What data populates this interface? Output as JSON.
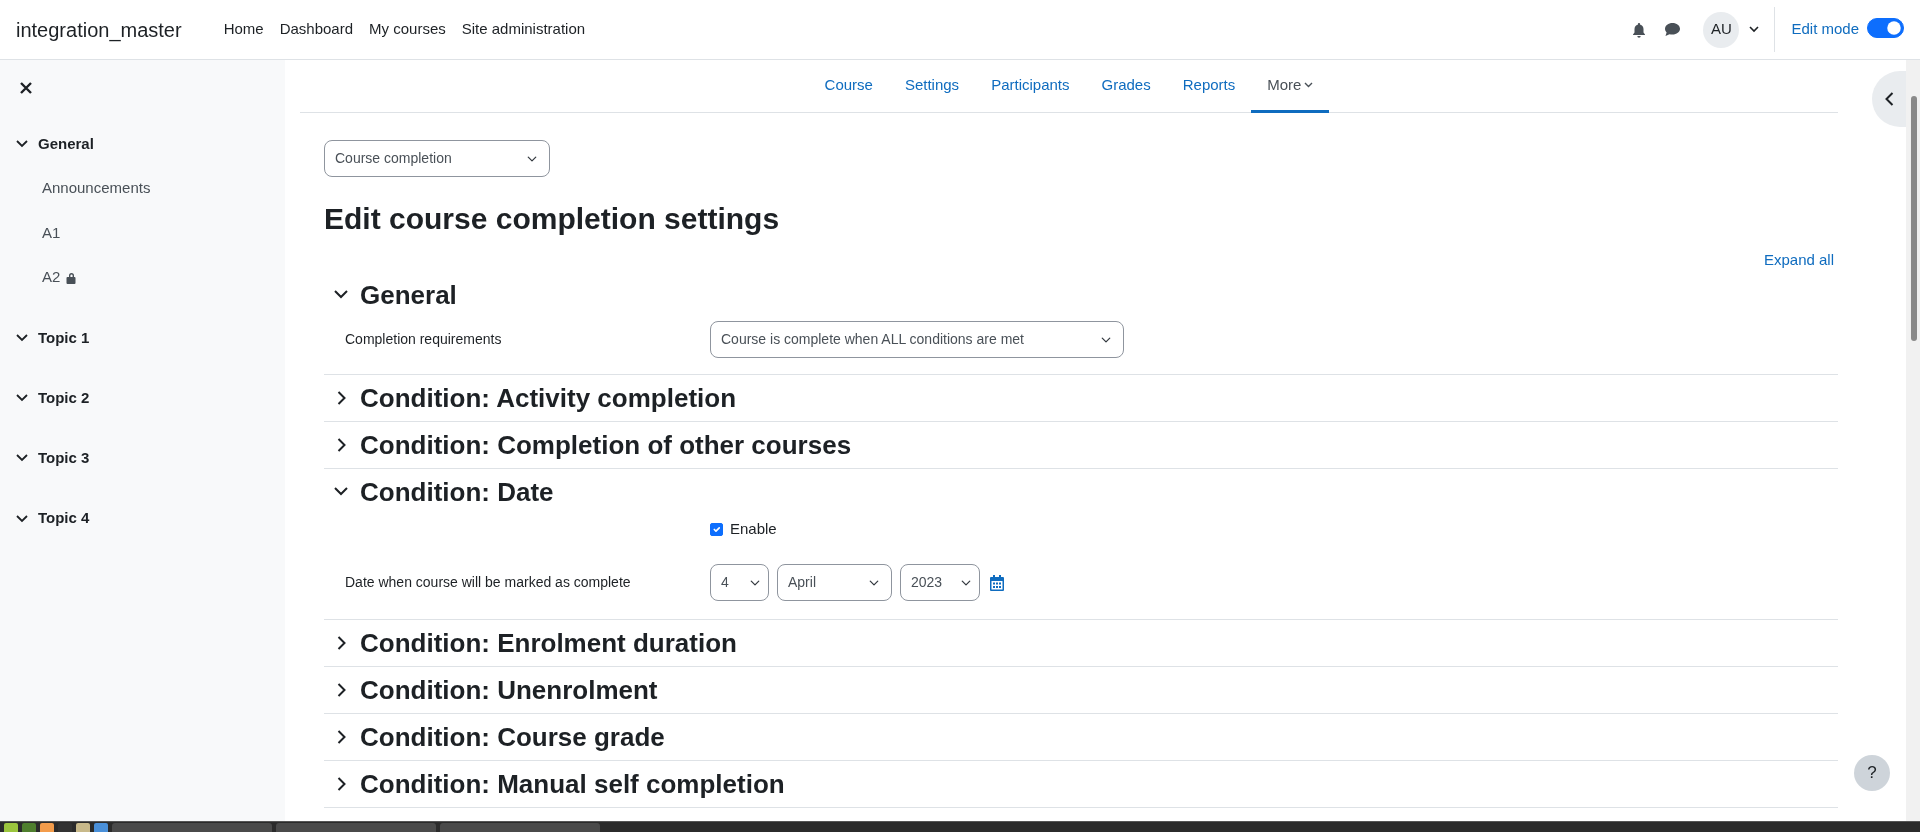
{
  "site_name": "integration_master",
  "primary_nav": [
    {
      "label": "Home"
    },
    {
      "label": "Dashboard"
    },
    {
      "label": "My courses"
    },
    {
      "label": "Site administration"
    }
  ],
  "user": {
    "initials": "AU"
  },
  "edit_mode": {
    "label": "Edit mode",
    "on": true
  },
  "course_index": [
    {
      "label": "General",
      "expanded": true,
      "children": [
        {
          "label": "Announcements",
          "locked": false
        },
        {
          "label": "A1",
          "locked": false
        },
        {
          "label": "A2",
          "locked": true
        }
      ]
    },
    {
      "label": "Topic 1",
      "expanded": true
    },
    {
      "label": "Topic 2",
      "expanded": true
    },
    {
      "label": "Topic 3",
      "expanded": true
    },
    {
      "label": "Topic 4",
      "expanded": true
    }
  ],
  "secondary_nav": [
    {
      "label": "Course",
      "selected": false
    },
    {
      "label": "Settings",
      "selected": false
    },
    {
      "label": "Participants",
      "selected": false
    },
    {
      "label": "Grades",
      "selected": false
    },
    {
      "label": "Reports",
      "selected": false
    },
    {
      "label": "More",
      "selected": true,
      "dropdown": true
    }
  ],
  "page_select": {
    "value": "Course completion"
  },
  "title": "Edit course completion settings",
  "expand_all": "Expand all",
  "sections": [
    {
      "title": "General",
      "expanded": true,
      "fields": [
        {
          "kind": "select",
          "label": "Completion requirements",
          "value": "Course is complete when ALL conditions are met"
        }
      ]
    },
    {
      "title": "Condition: Activity completion",
      "expanded": false
    },
    {
      "title": "Condition: Completion of other courses",
      "expanded": false
    },
    {
      "title": "Condition: Date",
      "expanded": true,
      "fields": [
        {
          "kind": "checkbox",
          "label": "Enable",
          "checked": true
        },
        {
          "kind": "date",
          "label": "Date when course will be marked as complete",
          "day": "4",
          "month": "April",
          "year": "2023"
        }
      ]
    },
    {
      "title": "Condition: Enrolment duration",
      "expanded": false
    },
    {
      "title": "Condition: Unenrolment",
      "expanded": false
    },
    {
      "title": "Condition: Course grade",
      "expanded": false
    },
    {
      "title": "Condition: Manual self completion",
      "expanded": false
    }
  ],
  "help_button": "?"
}
